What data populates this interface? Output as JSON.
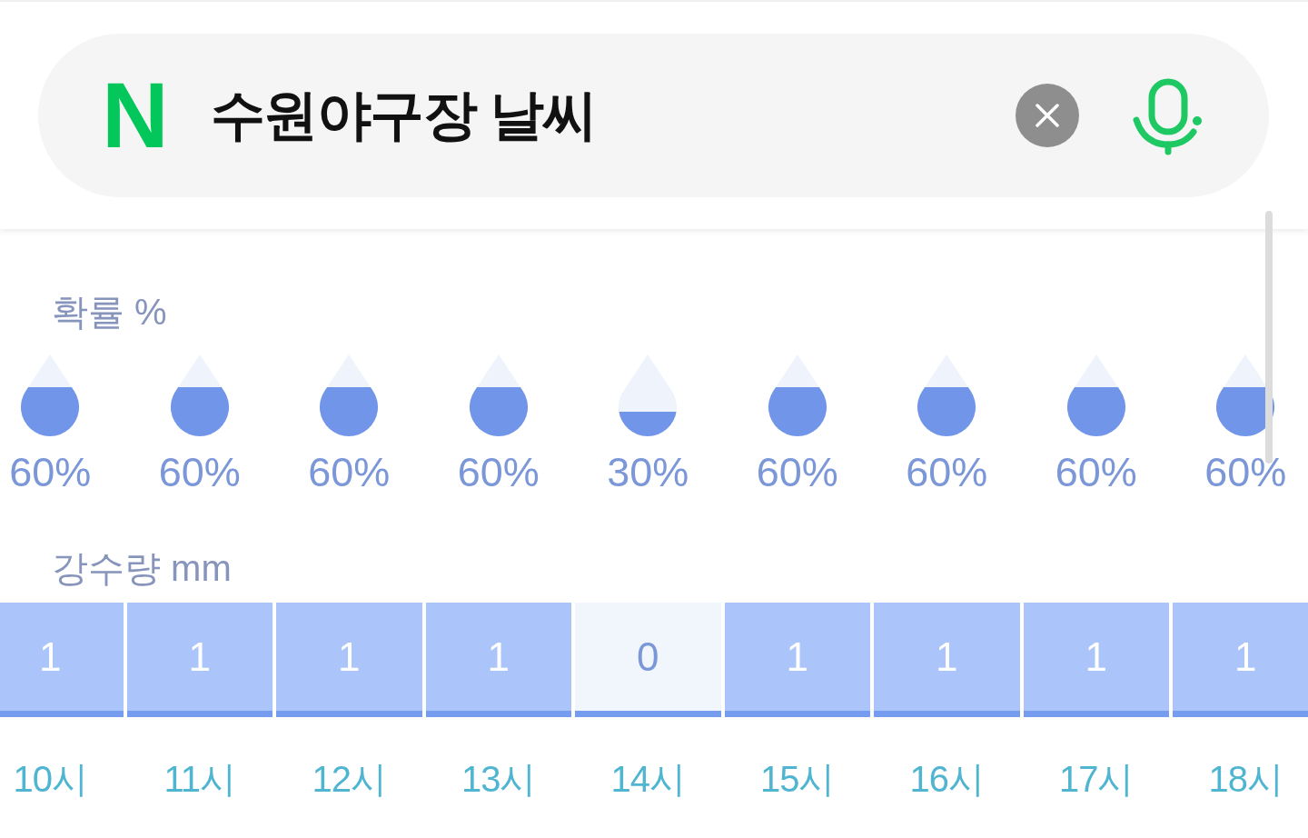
{
  "search": {
    "logo": "N",
    "value": "수원야구장 날씨"
  },
  "probability": {
    "title": "확률 %",
    "items": [
      {
        "level": 0.6,
        "label": "60%"
      },
      {
        "level": 0.6,
        "label": "60%"
      },
      {
        "level": 0.6,
        "label": "60%"
      },
      {
        "level": 0.6,
        "label": "60%"
      },
      {
        "level": 0.3,
        "label": "30%"
      },
      {
        "level": 0.6,
        "label": "60%"
      },
      {
        "level": 0.6,
        "label": "60%"
      },
      {
        "level": 0.6,
        "label": "60%"
      },
      {
        "level": 0.6,
        "label": "60%"
      }
    ]
  },
  "precipitation": {
    "title": "강수량 mm",
    "items": [
      {
        "kind": "rain",
        "amount": "1"
      },
      {
        "kind": "rain",
        "amount": "1"
      },
      {
        "kind": "rain",
        "amount": "1"
      },
      {
        "kind": "rain",
        "amount": "1"
      },
      {
        "kind": "none",
        "amount": "0"
      },
      {
        "kind": "rain",
        "amount": "1"
      },
      {
        "kind": "rain",
        "amount": "1"
      },
      {
        "kind": "rain",
        "amount": "1"
      },
      {
        "kind": "rain",
        "amount": "1"
      }
    ]
  },
  "hours": [
    "10시",
    "11시",
    "12시",
    "13시",
    "14시",
    "15시",
    "16시",
    "17시",
    "18시"
  ]
}
